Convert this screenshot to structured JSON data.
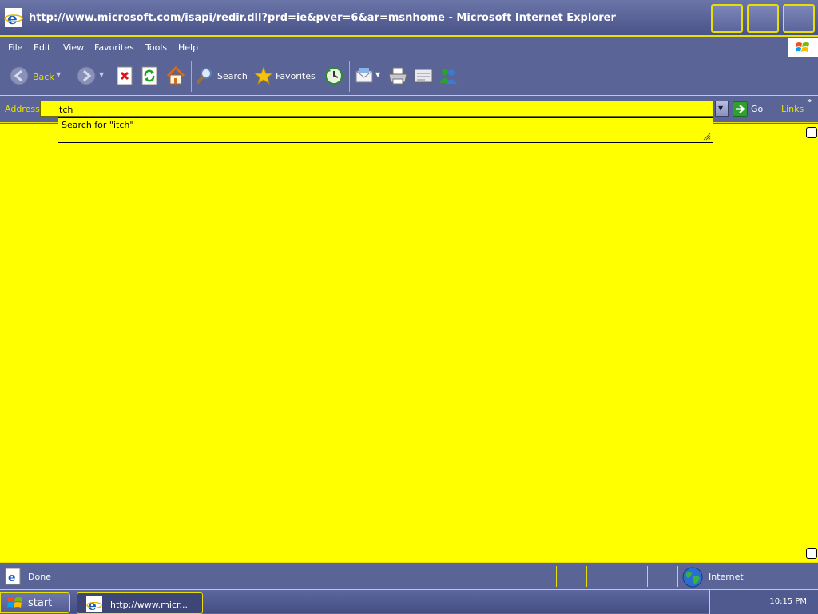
{
  "window": {
    "title": "http://www.microsoft.com/isapi/redir.dll?prd=ie&pver=6&ar=msnhome - Microsoft Internet Explorer"
  },
  "menu": {
    "items": [
      "File",
      "Edit",
      "View",
      "Favorites",
      "Tools",
      "Help"
    ]
  },
  "toolbar": {
    "back_label": "Back",
    "search_label": "Search",
    "favorites_label": "Favorites"
  },
  "address": {
    "label": "Address",
    "value": "itch",
    "go_label": "Go",
    "links_label": "Links",
    "links_chevron": "»"
  },
  "autocomplete": {
    "item": "Search for \"itch\""
  },
  "status": {
    "text": "Done",
    "zone": "Internet"
  },
  "taskbar": {
    "start_label": "start",
    "task_label": "http://www.micr...",
    "clock": "10:15 PM"
  },
  "colors": {
    "frame": "#5a6496",
    "accent": "#e8e000",
    "content_bg": "#ffff00"
  },
  "icons": [
    "ie-icon",
    "minimize-icon",
    "maximize-icon",
    "close-icon",
    "windows-logo-icon",
    "back-arrow-icon",
    "forward-arrow-icon",
    "stop-icon",
    "refresh-icon",
    "home-icon",
    "search-icon",
    "favorites-star-icon",
    "history-icon",
    "mail-icon",
    "print-icon",
    "edit-icon",
    "messenger-icon",
    "go-arrow-icon",
    "page-icon",
    "globe-icon"
  ]
}
